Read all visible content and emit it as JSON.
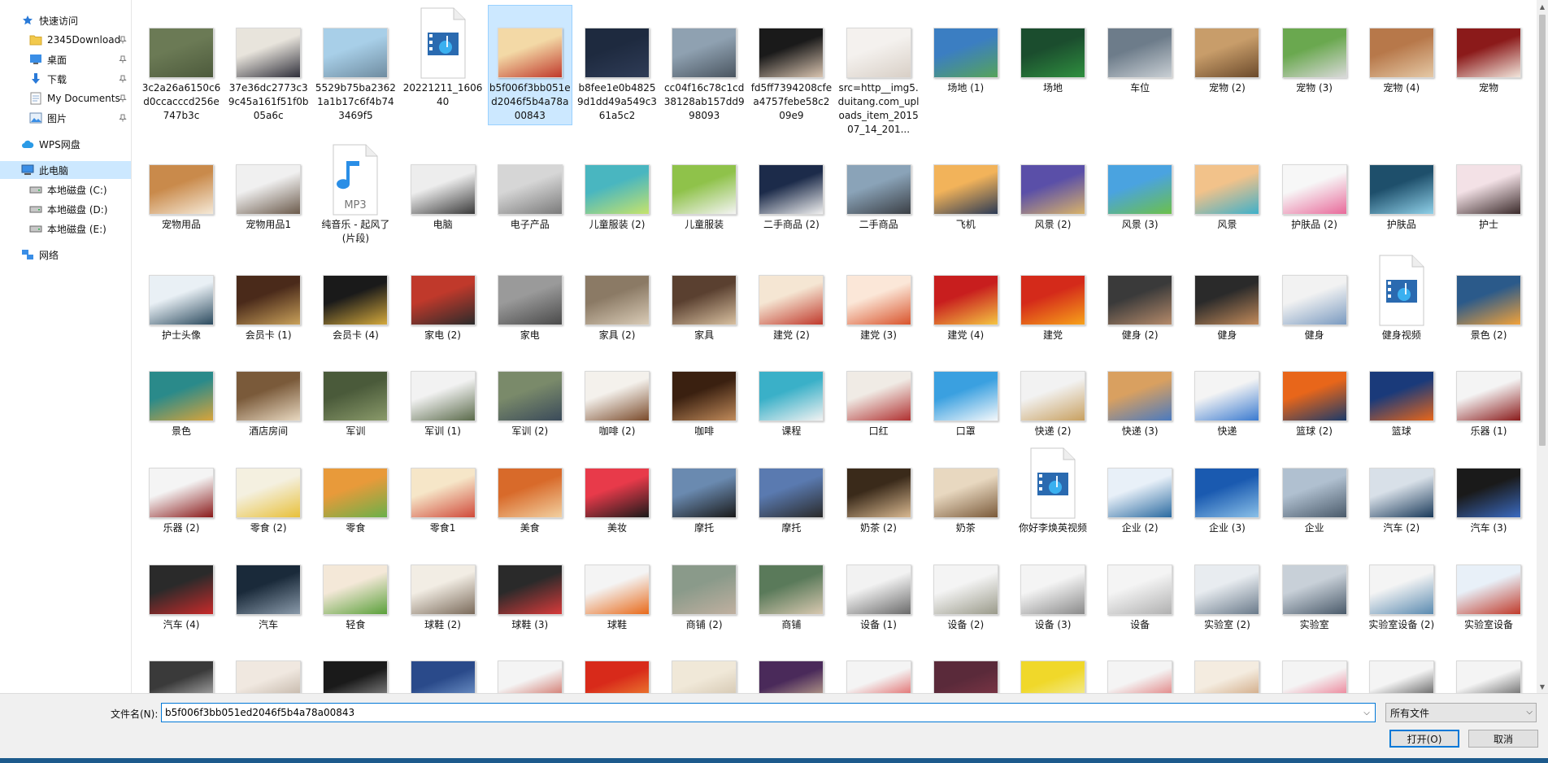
{
  "sidebar": {
    "items": [
      {
        "label": "快速访问",
        "icon": "star-icon",
        "pinned": false,
        "selected": false
      },
      {
        "label": "2345Download",
        "icon": "folder-icon",
        "pinned": true,
        "selected": false
      },
      {
        "label": "桌面",
        "icon": "desktop-icon",
        "pinned": true,
        "selected": false
      },
      {
        "label": "下载",
        "icon": "download-icon",
        "pinned": true,
        "selected": false
      },
      {
        "label": "My Documents",
        "icon": "documents-icon",
        "pinned": true,
        "selected": false
      },
      {
        "label": "图片",
        "icon": "pictures-icon",
        "pinned": true,
        "selected": false
      },
      {
        "label": "WPS网盘",
        "icon": "cloud-icon",
        "pinned": false,
        "selected": false
      },
      {
        "label": "此电脑",
        "icon": "computer-icon",
        "pinned": false,
        "selected": true
      },
      {
        "label": "本地磁盘 (C:)",
        "icon": "drive-icon",
        "pinned": false,
        "selected": false
      },
      {
        "label": "本地磁盘 (D:)",
        "icon": "drive-icon",
        "pinned": false,
        "selected": false
      },
      {
        "label": "本地磁盘 (E:)",
        "icon": "drive-icon",
        "pinned": false,
        "selected": false
      },
      {
        "label": "网络",
        "icon": "network-icon",
        "pinned": false,
        "selected": false
      }
    ]
  },
  "files": {
    "rows": [
      [
        {
          "name": "3c2a26a6150c6d0ccacccd256e747b3c",
          "kind": "image",
          "colors": [
            "#6b7a55",
            "#4d5a3c"
          ]
        },
        {
          "name": "37e36dc2773c39c45a161f51f0b05a6c",
          "kind": "image",
          "colors": [
            "#e8e4dc",
            "#2f2f3a"
          ]
        },
        {
          "name": "5529b75ba23621a1b17c6f4b743469f5",
          "kind": "image",
          "colors": [
            "#a8cfe8",
            "#6f8ca0"
          ]
        },
        {
          "name": "20221211_160640",
          "kind": "video"
        },
        {
          "name": "b5f006f3bb051ed2046f5b4a78a00843",
          "kind": "image",
          "colors": [
            "#f3d9a6",
            "#c0392b"
          ],
          "selected": true
        },
        {
          "name": "b8fee1e0b48259d1dd49a549c361a5c2",
          "kind": "image",
          "colors": [
            "#1e2a3f",
            "#2f3c57"
          ]
        },
        {
          "name": "cc04f16c78c1cd38128ab157dd998093",
          "kind": "image",
          "colors": [
            "#8fa1b1",
            "#4a5560"
          ]
        },
        {
          "name": "fd5ff7394208cfea4757febe58c209e9",
          "kind": "image",
          "colors": [
            "#1a1a1a",
            "#d9c4b0"
          ]
        },
        {
          "name": "src=http__img5.duitang.com_uploads_item_201507_14_201...",
          "kind": "image",
          "colors": [
            "#f4f1ee",
            "#d8cfc6"
          ]
        },
        {
          "name": "场地 (1)",
          "kind": "image",
          "colors": [
            "#3b7ec2",
            "#56a35a"
          ]
        },
        {
          "name": "场地",
          "kind": "image",
          "colors": [
            "#1b4d2e",
            "#2f8f3f"
          ]
        },
        {
          "name": "车位",
          "kind": "image",
          "colors": [
            "#6d7c8a",
            "#c9cfd4"
          ]
        },
        {
          "name": "宠物 (2)",
          "kind": "image",
          "colors": [
            "#c89d6a",
            "#6b4a2b"
          ]
        },
        {
          "name": "宠物 (3)",
          "kind": "image",
          "colors": [
            "#6aa84f",
            "#d9d9d9"
          ]
        },
        {
          "name": "宠物 (4)",
          "kind": "image",
          "colors": [
            "#b7784a",
            "#e5c9a6"
          ]
        },
        {
          "name": "宠物",
          "kind": "image",
          "colors": [
            "#8b1a1a",
            "#f2e6dc"
          ]
        }
      ],
      [
        {
          "name": "宠物用品",
          "kind": "image",
          "colors": [
            "#c98a4b",
            "#f5e9d7"
          ]
        },
        {
          "name": "宠物用品1",
          "kind": "image",
          "colors": [
            "#f0f0f0",
            "#6b5a4b"
          ]
        },
        {
          "name": "纯音乐 - 起风了(片段)",
          "kind": "audio"
        },
        {
          "name": "电脑",
          "kind": "image",
          "colors": [
            "#ededed",
            "#3a3a3a"
          ]
        },
        {
          "name": "电子产品",
          "kind": "image",
          "colors": [
            "#d6d6d6",
            "#7a7a7a"
          ]
        },
        {
          "name": "儿童服装 (2)",
          "kind": "image",
          "colors": [
            "#49b6c0",
            "#c6e36b"
          ]
        },
        {
          "name": "儿童服装",
          "kind": "image",
          "colors": [
            "#8fc24a",
            "#f4f4f4"
          ]
        },
        {
          "name": "二手商品 (2)",
          "kind": "image",
          "colors": [
            "#1c2b4a",
            "#f0f0f0"
          ]
        },
        {
          "name": "二手商品",
          "kind": "image",
          "colors": [
            "#8aa3b8",
            "#3b3f45"
          ]
        },
        {
          "name": "飞机",
          "kind": "image",
          "colors": [
            "#f2b35a",
            "#2b3a55"
          ]
        },
        {
          "name": "风景 (2)",
          "kind": "image",
          "colors": [
            "#5a4fa8",
            "#d9b36a"
          ]
        },
        {
          "name": "风景 (3)",
          "kind": "image",
          "colors": [
            "#4aa3e0",
            "#6cc04a"
          ]
        },
        {
          "name": "风景",
          "kind": "image",
          "colors": [
            "#f2c28a",
            "#3fb0c9"
          ]
        },
        {
          "name": "护肤品 (2)",
          "kind": "image",
          "colors": [
            "#f7f7f7",
            "#e86a9a"
          ]
        },
        {
          "name": "护肤品",
          "kind": "image",
          "colors": [
            "#1e4f6b",
            "#8fd0e8"
          ]
        },
        {
          "name": "护士",
          "kind": "image",
          "colors": [
            "#f3e1e6",
            "#3a2a2a"
          ]
        }
      ],
      [
        {
          "name": "护士头像",
          "kind": "image",
          "colors": [
            "#e9f0f5",
            "#2b4a5e"
          ]
        },
        {
          "name": "会员卡 (1)",
          "kind": "image",
          "colors": [
            "#4a2a1a",
            "#c9a15a"
          ]
        },
        {
          "name": "会员卡 (4)",
          "kind": "image",
          "colors": [
            "#1a1a1a",
            "#d4a93c"
          ]
        },
        {
          "name": "家电 (2)",
          "kind": "image",
          "colors": [
            "#c0392b",
            "#2b2b2b"
          ]
        },
        {
          "name": "家电",
          "kind": "image",
          "colors": [
            "#9a9a9a",
            "#4a4a4a"
          ]
        },
        {
          "name": "家具 (2)",
          "kind": "image",
          "colors": [
            "#8b7a65",
            "#d9cbb6"
          ]
        },
        {
          "name": "家具",
          "kind": "image",
          "colors": [
            "#5a4030",
            "#d8c0a0"
          ]
        },
        {
          "name": "建党 (2)",
          "kind": "image",
          "colors": [
            "#f5e6d3",
            "#c0392b"
          ]
        },
        {
          "name": "建党 (3)",
          "kind": "image",
          "colors": [
            "#fbe7d8",
            "#d9532b"
          ]
        },
        {
          "name": "建党 (4)",
          "kind": "image",
          "colors": [
            "#c81e1e",
            "#f4c542"
          ]
        },
        {
          "name": "建党",
          "kind": "image",
          "colors": [
            "#d42a1a",
            "#f7a21a"
          ]
        },
        {
          "name": "健身 (2)",
          "kind": "image",
          "colors": [
            "#3a3a3a",
            "#b58a6a"
          ]
        },
        {
          "name": "健身",
          "kind": "image",
          "colors": [
            "#2a2a2a",
            "#c28a5a"
          ]
        },
        {
          "name": "健身",
          "kind": "image",
          "colors": [
            "#f2f2f2",
            "#7a9ac0"
          ]
        },
        {
          "name": "健身视频",
          "kind": "video"
        },
        {
          "name": "景色 (2)",
          "kind": "image",
          "colors": [
            "#2b5a8a",
            "#f2a23a"
          ]
        }
      ],
      [
        {
          "name": "景色",
          "kind": "image",
          "colors": [
            "#2a8a8a",
            "#d9a43a"
          ]
        },
        {
          "name": "酒店房间",
          "kind": "image",
          "colors": [
            "#7a5a3a",
            "#e8d8c0"
          ]
        },
        {
          "name": "军训",
          "kind": "image",
          "colors": [
            "#4a5a3a",
            "#8a9a6a"
          ]
        },
        {
          "name": "军训 (1)",
          "kind": "image",
          "colors": [
            "#f2f2f2",
            "#5a6a4a"
          ]
        },
        {
          "name": "军训 (2)",
          "kind": "image",
          "colors": [
            "#7a8a6a",
            "#3a4a5a"
          ]
        },
        {
          "name": "咖啡 (2)",
          "kind": "image",
          "colors": [
            "#f4f1ec",
            "#7a4a2a"
          ]
        },
        {
          "name": "咖啡",
          "kind": "image",
          "colors": [
            "#3a2010",
            "#c08a5a"
          ]
        },
        {
          "name": "课程",
          "kind": "image",
          "colors": [
            "#3ab0c8",
            "#f2f2f2"
          ]
        },
        {
          "name": "口红",
          "kind": "image",
          "colors": [
            "#f0ebe5",
            "#b03030"
          ]
        },
        {
          "name": "口罩",
          "kind": "image",
          "colors": [
            "#3aa0e0",
            "#f4f8fb"
          ]
        },
        {
          "name": "快递 (2)",
          "kind": "image",
          "colors": [
            "#f2f2f2",
            "#c8a060"
          ]
        },
        {
          "name": "快递 (3)",
          "kind": "image",
          "colors": [
            "#d9a060",
            "#4a7ac0"
          ]
        },
        {
          "name": "快递",
          "kind": "image",
          "colors": [
            "#f4f4f4",
            "#3a7ad0"
          ]
        },
        {
          "name": "篮球 (2)",
          "kind": "image",
          "colors": [
            "#e8661a",
            "#1a3a6a"
          ]
        },
        {
          "name": "篮球",
          "kind": "image",
          "colors": [
            "#1a3a7a",
            "#e8661a"
          ]
        },
        {
          "name": "乐器 (1)",
          "kind": "image",
          "colors": [
            "#f4f4f4",
            "#8a1a1a"
          ]
        }
      ],
      [
        {
          "name": "乐器 (2)",
          "kind": "image",
          "colors": [
            "#f4f4f4",
            "#8a1a1a"
          ]
        },
        {
          "name": "零食 (2)",
          "kind": "image",
          "colors": [
            "#f4f0e0",
            "#e8c03a"
          ]
        },
        {
          "name": "零食",
          "kind": "image",
          "colors": [
            "#e89a3a",
            "#6ab04a"
          ]
        },
        {
          "name": "零食1",
          "kind": "image",
          "colors": [
            "#f6e6c8",
            "#d04a3a"
          ]
        },
        {
          "name": "美食",
          "kind": "image",
          "colors": [
            "#d86a2a",
            "#f2d0a0"
          ]
        },
        {
          "name": "美妆",
          "kind": "image",
          "colors": [
            "#e83a4a",
            "#1a1a1a"
          ]
        },
        {
          "name": "摩托",
          "kind": "image",
          "colors": [
            "#6a8ab0",
            "#1a1a1a"
          ]
        },
        {
          "name": "摩托",
          "kind": "image",
          "colors": [
            "#5a7ab0",
            "#2a2a2a"
          ]
        },
        {
          "name": "奶茶 (2)",
          "kind": "image",
          "colors": [
            "#3a2a1a",
            "#d8b890"
          ]
        },
        {
          "name": "奶茶",
          "kind": "image",
          "colors": [
            "#e8d8c0",
            "#7a5a3a"
          ]
        },
        {
          "name": "你好李焕英视频",
          "kind": "video"
        },
        {
          "name": "企业 (2)",
          "kind": "image",
          "colors": [
            "#e8f0f8",
            "#2a6aa0"
          ]
        },
        {
          "name": "企业 (3)",
          "kind": "image",
          "colors": [
            "#1a5ab0",
            "#8ac0e8"
          ]
        },
        {
          "name": "企业",
          "kind": "image",
          "colors": [
            "#b0c0d0",
            "#4a5a6a"
          ]
        },
        {
          "name": "汽车 (2)",
          "kind": "image",
          "colors": [
            "#d8e0e8",
            "#1a3a5a"
          ]
        },
        {
          "name": "汽车 (3)",
          "kind": "image",
          "colors": [
            "#1a1a1a",
            "#3a6ac0"
          ]
        }
      ],
      [
        {
          "name": "汽车 (4)",
          "kind": "image",
          "colors": [
            "#2a2a2a",
            "#c82a2a"
          ]
        },
        {
          "name": "汽车",
          "kind": "image",
          "colors": [
            "#1a2a3a",
            "#8a9aaa"
          ]
        },
        {
          "name": "轻食",
          "kind": "image",
          "colors": [
            "#f4e8d8",
            "#5aa03a"
          ]
        },
        {
          "name": "球鞋 (2)",
          "kind": "image",
          "colors": [
            "#f2ede4",
            "#7a6a5a"
          ]
        },
        {
          "name": "球鞋 (3)",
          "kind": "image",
          "colors": [
            "#2a2a2a",
            "#d83a3a"
          ]
        },
        {
          "name": "球鞋",
          "kind": "image",
          "colors": [
            "#f4f4f4",
            "#e86a1a"
          ]
        },
        {
          "name": "商铺 (2)",
          "kind": "image",
          "colors": [
            "#8a9a8a",
            "#c0b0a0"
          ]
        },
        {
          "name": "商铺",
          "kind": "image",
          "colors": [
            "#5a7a5a",
            "#d8c8b0"
          ]
        },
        {
          "name": "设备 (1)",
          "kind": "image",
          "colors": [
            "#f2f2f2",
            "#6a6a6a"
          ]
        },
        {
          "name": "设备 (2)",
          "kind": "image",
          "colors": [
            "#f4f4f4",
            "#9a9a8a"
          ]
        },
        {
          "name": "设备 (3)",
          "kind": "image",
          "colors": [
            "#f4f4f4",
            "#8a8a8a"
          ]
        },
        {
          "name": "设备",
          "kind": "image",
          "colors": [
            "#f4f4f4",
            "#b0b0b0"
          ]
        },
        {
          "name": "实验室 (2)",
          "kind": "image",
          "colors": [
            "#e8ecf0",
            "#6a7a8a"
          ]
        },
        {
          "name": "实验室",
          "kind": "image",
          "colors": [
            "#c8d0d8",
            "#4a5a6a"
          ]
        },
        {
          "name": "实验室设备 (2)",
          "kind": "image",
          "colors": [
            "#f4f4f4",
            "#5a8ab0"
          ]
        },
        {
          "name": "实验室设备",
          "kind": "image",
          "colors": [
            "#e8f0f8",
            "#c03a2a"
          ]
        }
      ],
      [
        {
          "name": "",
          "kind": "image",
          "colors": [
            "#3a3a3a",
            "#d8d8d8"
          ]
        },
        {
          "name": "",
          "kind": "image",
          "colors": [
            "#f0e8e0",
            "#b0a090"
          ]
        },
        {
          "name": "",
          "kind": "image",
          "colors": [
            "#1a1a1a",
            "#b0b0b0"
          ]
        },
        {
          "name": "",
          "kind": "image",
          "colors": [
            "#2a4a8a",
            "#8ab0e0"
          ]
        },
        {
          "name": "",
          "kind": "image",
          "colors": [
            "#f4f4f4",
            "#c03a2a"
          ]
        },
        {
          "name": "",
          "kind": "image",
          "colors": [
            "#d82a1a",
            "#f4a03a"
          ]
        },
        {
          "name": "",
          "kind": "image",
          "colors": [
            "#f0e8d8",
            "#c8b8a0"
          ]
        },
        {
          "name": "",
          "kind": "image",
          "colors": [
            "#4a2a5a",
            "#e8d0a0"
          ]
        },
        {
          "name": "",
          "kind": "image",
          "colors": [
            "#f4f4f4",
            "#d82a2a"
          ]
        },
        {
          "name": "",
          "kind": "image",
          "colors": [
            "#5a2a3a",
            "#8a3a4a"
          ]
        },
        {
          "name": "",
          "kind": "image",
          "colors": [
            "#f0d82a",
            "#f4f4c0"
          ]
        },
        {
          "name": "",
          "kind": "image",
          "colors": [
            "#f4f4f4",
            "#d84a4a"
          ]
        },
        {
          "name": "",
          "kind": "image",
          "colors": [
            "#f4ece0",
            "#c08a5a"
          ]
        },
        {
          "name": "",
          "kind": "image",
          "colors": [
            "#f4f4f4",
            "#e84a6a"
          ]
        },
        {
          "name": "",
          "kind": "image",
          "colors": [
            "#f4f4f4",
            "#1a1a1a"
          ]
        },
        {
          "name": "",
          "kind": "image",
          "colors": [
            "#f4f4f4",
            "#2a2a2a"
          ]
        }
      ]
    ]
  },
  "bottom": {
    "filename_label": "文件名(N):",
    "filename_value": "b5f006f3bb051ed2046f5b4a78a00843",
    "filter_value": "所有文件",
    "open_label": "打开(O)",
    "cancel_label": "取消"
  },
  "colors": {
    "selection": "#cce8ff",
    "accent": "#0078d7"
  }
}
